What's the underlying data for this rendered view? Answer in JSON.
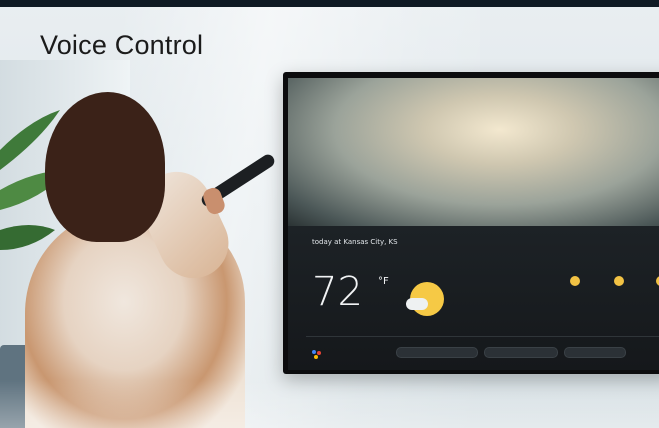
{
  "heading": "Voice Control",
  "tv": {
    "location": "today at Kansas City, KS",
    "subtitle": "",
    "temperature": "72",
    "unit": "°F",
    "high": "",
    "low": "",
    "forecast": [
      {
        "day": ""
      },
      {
        "day": ""
      },
      {
        "day": ""
      }
    ],
    "try_label": "",
    "suggestions": [
      "",
      "",
      ""
    ]
  },
  "colors": {
    "title_text": "#1b1b1b",
    "sun": "#f6c945",
    "tv_frame": "#0c0c0e"
  }
}
